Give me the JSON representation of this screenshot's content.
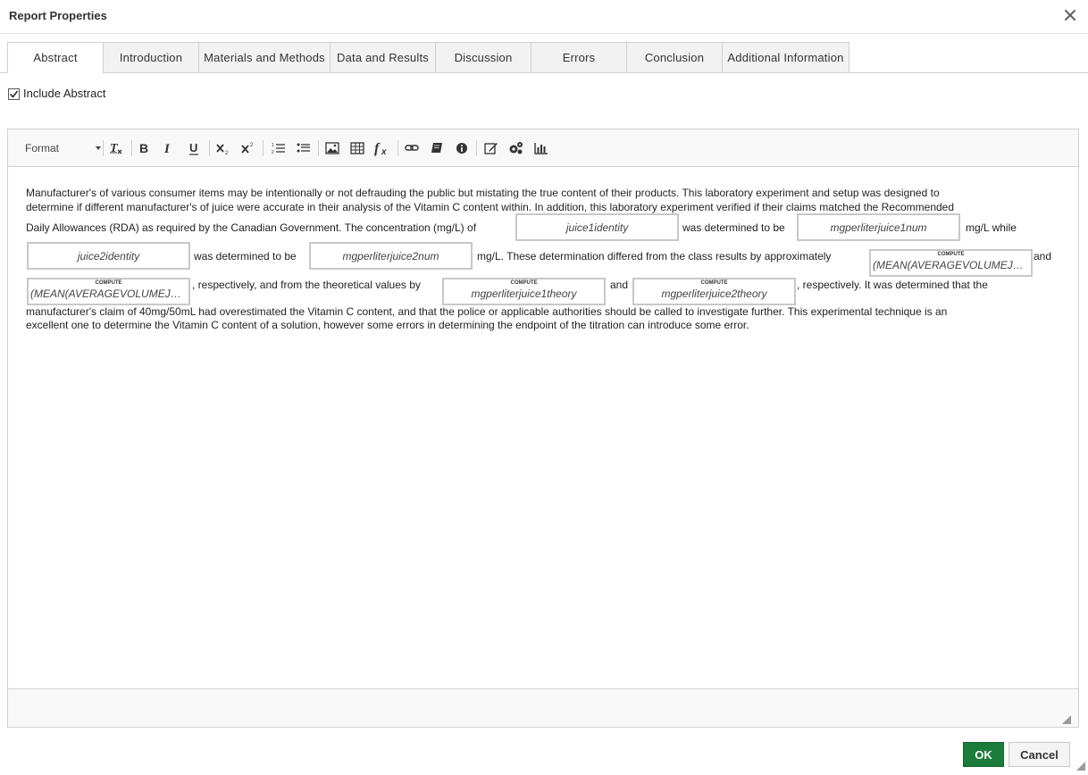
{
  "dialog": {
    "title": "Report Properties",
    "close_icon": "close-icon"
  },
  "tabs": [
    {
      "label": "Abstract",
      "active": true
    },
    {
      "label": "Introduction"
    },
    {
      "label": "Materials and Methods"
    },
    {
      "label": "Data and Results"
    },
    {
      "label": "Discussion"
    },
    {
      "label": "Errors"
    },
    {
      "label": "Conclusion"
    },
    {
      "label": "Additional Information"
    }
  ],
  "include_abstract": {
    "label": "Include Abstract",
    "checked": true
  },
  "toolbar": {
    "format_label": "Format",
    "buttons": [
      "remove-format-icon",
      "bold-icon",
      "italic-icon",
      "underline-icon",
      "subscript-icon",
      "superscript-icon",
      "numbered-list-icon",
      "bulleted-list-icon",
      "image-icon",
      "table-icon",
      "formula-icon",
      "link-icon",
      "book-icon",
      "info-icon",
      "edit-icon",
      "settings-icon",
      "chart-icon"
    ]
  },
  "content": {
    "line1": "Manufacturer's of various consumer items may be intentionally or not defrauding the public but mistating the true content of their products. This laboratory experiment and setup was designed to",
    "line2": "determine if different manufacturer's of juice were accurate in their analysis of the Vitamin C content within. In addition, this laboratory experiment verified if their claims matched the Recommended",
    "line3a": "Daily Allowances (RDA) as required by the Canadian Government. The concentration (mg/L) of",
    "line3b": "was determined to be",
    "line3c": "mg/L while",
    "line4a": "was determined to be",
    "line4b": "mg/L. These determination differed from the class results by approximately",
    "line4c": "and",
    "line5a": ", respectively, and from the theoretical values by",
    "line5b": "and",
    "line5c": ", respectively. It was determined that the",
    "line6": "manufacturer's claim of 40mg/50mL had overestimated the Vitamin C content, and that the police or applicable authorities should be called to investigate further.  This experimental technique is an",
    "line7": "excellent one to determine the Vitamin C content of a solution, however some errors in determining the endpoint of the titration can introduce some error.",
    "fields": {
      "juice1identity": "juice1identity",
      "mgperliterjuice1num": "mgperliterjuice1num",
      "juice2identity": "juice2identity",
      "mgperliterjuice2num": "mgperliterjuice2num",
      "compute_label": "COMPUTE",
      "compute1": "(MEAN(AVERAGEVOLUMEJU...",
      "compute2": "(MEAN(AVERAGEVOLUMEJU...",
      "compute3": "mgperliterjuice1theory",
      "compute4": "mgperliterjuice2theory"
    }
  },
  "footer": {
    "ok_label": "OK",
    "cancel_label": "Cancel"
  }
}
